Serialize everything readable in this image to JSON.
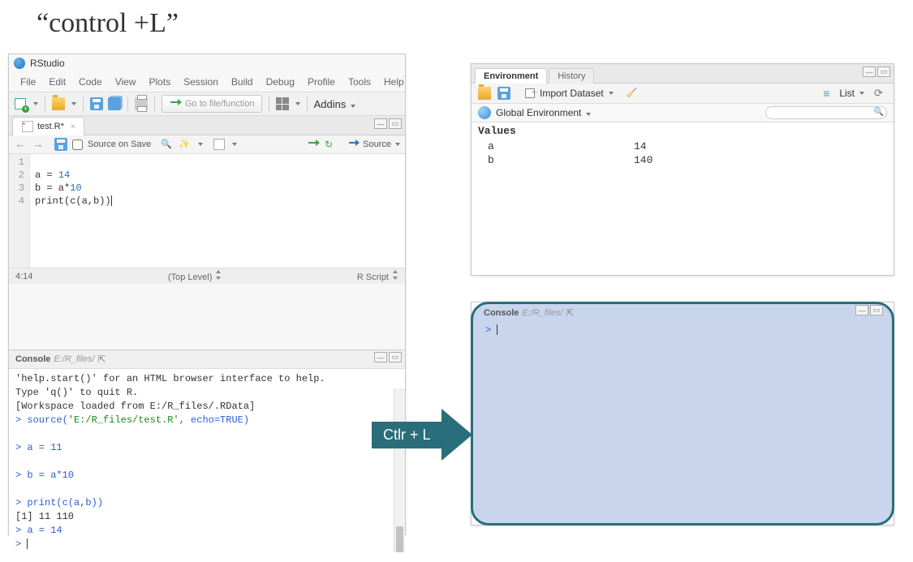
{
  "slide_title": "“control +L”",
  "app_name": "RStudio",
  "menu": [
    "File",
    "Edit",
    "Code",
    "View",
    "Plots",
    "Session",
    "Build",
    "Debug",
    "Profile",
    "Tools",
    "Help"
  ],
  "main_toolbar": {
    "goto_placeholder": "Go to file/function",
    "addins_label": "Addins"
  },
  "editor": {
    "tab_label": "test.R*",
    "source_on_save": "Source on Save",
    "source_btn": "Source",
    "lines": {
      "1": "",
      "2_a": "a = ",
      "2_b": "14",
      "3_a": "b = a*",
      "3_b": "10",
      "4": "print(c(a,b))"
    },
    "line_numbers": [
      "1",
      "2",
      "3",
      "4"
    ],
    "cursor_pos": "4:14",
    "scope": "(Top Level)",
    "lang": "R Script"
  },
  "console_left": {
    "title": "Console",
    "path": "E:/R_files/",
    "lines": [
      {
        "cls": "",
        "txt": "'help.start()' for an HTML browser interface to help."
      },
      {
        "cls": "",
        "txt": "Type 'q()' to quit R."
      },
      {
        "cls": "",
        "txt": ""
      },
      {
        "cls": "",
        "txt": "[Workspace loaded from E:/R_files/.RData]"
      },
      {
        "cls": "",
        "txt": ""
      }
    ],
    "source_cmd_prefix": "> source(",
    "source_cmd_str": "'E:/R_files/test.R'",
    "source_cmd_suffix": ", echo=TRUE)",
    "rest": [
      {
        "cls": "blue",
        "txt": "> a = 11"
      },
      {
        "cls": "",
        "txt": ""
      },
      {
        "cls": "blue",
        "txt": "> b = a*10"
      },
      {
        "cls": "",
        "txt": ""
      },
      {
        "cls": "blue",
        "txt": "> print(c(a,b))"
      },
      {
        "cls": "",
        "txt": "[1]  11 110"
      },
      {
        "cls": "blue",
        "txt": "> a = 14"
      },
      {
        "cls": "blue",
        "txt": "> "
      }
    ]
  },
  "env_panel": {
    "tabs": {
      "env": "Environment",
      "hist": "History"
    },
    "import_label": "Import Dataset",
    "list_label": "List",
    "scope_label": "Global Environment",
    "search_placeholder": "",
    "section": "Values",
    "rows": [
      {
        "name": "a",
        "val": "14"
      },
      {
        "name": "b",
        "val": "140"
      }
    ]
  },
  "console_right": {
    "title": "Console",
    "path": "E:/R_files/",
    "prompt": "> "
  },
  "arrow_label": "Ctlr  + L"
}
